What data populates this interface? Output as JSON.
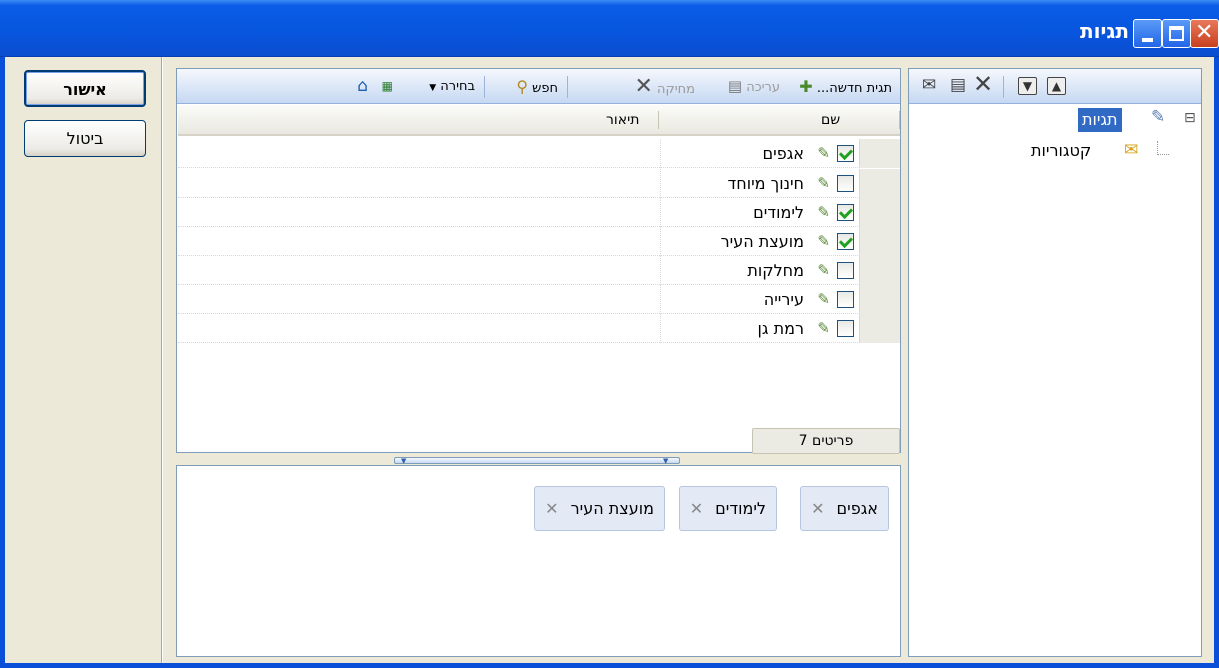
{
  "window": {
    "title": "תגיות"
  },
  "buttons": {
    "ok": "אישור",
    "cancel": "ביטול"
  },
  "tree": {
    "root_label": "תגיות",
    "child_label": "קטגוריות",
    "toggle": "⊟"
  },
  "list_toolbar": {
    "new_tag": "תגית חדשה...",
    "edit": "עריכה",
    "delete": "מחיקה",
    "search": "חפש",
    "select": "בחירה"
  },
  "columns": {
    "name": "שם",
    "description": "תיאור"
  },
  "rows": [
    {
      "name": "אגפים",
      "checked": true
    },
    {
      "name": "חינוך מיוחד",
      "checked": false
    },
    {
      "name": "לימודים",
      "checked": true
    },
    {
      "name": "מועצת העיר",
      "checked": true
    },
    {
      "name": "מחלקות",
      "checked": false
    },
    {
      "name": "עירייה",
      "checked": false
    },
    {
      "name": "רמת גן",
      "checked": false
    }
  ],
  "count_text": "פריטים 7",
  "chips": [
    "אגפים",
    "לימודים",
    "מועצת העיר"
  ],
  "colors": {
    "accent": "#316ac5",
    "title_bar": "#0855dd",
    "face": "#ece9d8"
  }
}
